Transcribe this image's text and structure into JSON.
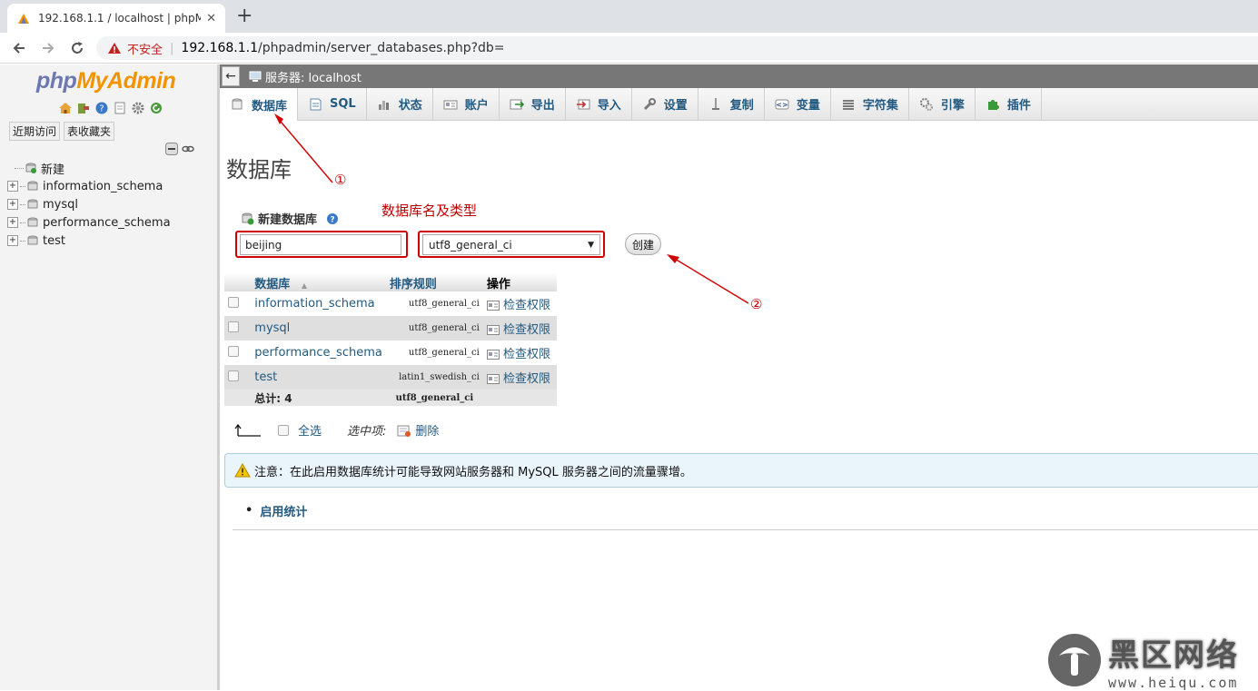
{
  "browser": {
    "tab_title": "192.168.1.1 / localhost | phpM",
    "tab_close": "✕",
    "new_tab": "+",
    "security_label": "不安全",
    "url_host": "192.168.1.1",
    "url_path": "/phpadmin/server_databases.php?db="
  },
  "sidebar": {
    "logo_php": "php",
    "logo_myadmin": "MyAdmin",
    "recent_label": "近期访问",
    "favorites_label": "表收藏夹",
    "tree": [
      {
        "label": "新建"
      },
      {
        "label": "information_schema"
      },
      {
        "label": "mysql"
      },
      {
        "label": "performance_schema"
      },
      {
        "label": "test"
      }
    ]
  },
  "server_bar": {
    "back": "←",
    "label": "服务器: localhost"
  },
  "menu": {
    "tabs": [
      {
        "label": "数据库",
        "icon": "database-icon"
      },
      {
        "label": "SQL",
        "icon": "sql-icon"
      },
      {
        "label": "状态",
        "icon": "status-icon"
      },
      {
        "label": "账户",
        "icon": "accounts-icon"
      },
      {
        "label": "导出",
        "icon": "export-icon"
      },
      {
        "label": "导入",
        "icon": "import-icon"
      },
      {
        "label": "设置",
        "icon": "wrench-icon"
      },
      {
        "label": "复制",
        "icon": "replication-icon"
      },
      {
        "label": "变量",
        "icon": "variables-icon"
      },
      {
        "label": "字符集",
        "icon": "charset-icon"
      },
      {
        "label": "引擎",
        "icon": "engine-icon"
      },
      {
        "label": "插件",
        "icon": "plugin-icon"
      }
    ]
  },
  "page": {
    "title": "数据库",
    "create_label": "新建数据库",
    "annotation_text": "数据库名及类型",
    "dbname_value": "beijing",
    "collation_value": "utf8_general_ci",
    "create_button": "创建",
    "marker_1": "①",
    "marker_2": "②"
  },
  "table": {
    "headers": {
      "database": "数据库",
      "sort": "▲",
      "collation": "排序规则",
      "action": "操作"
    },
    "rows": [
      {
        "name": "information_schema",
        "collation": "utf8_general_ci",
        "action": "检查权限"
      },
      {
        "name": "mysql",
        "collation": "utf8_general_ci",
        "action": "检查权限"
      },
      {
        "name": "performance_schema",
        "collation": "utf8_general_ci",
        "action": "检查权限"
      },
      {
        "name": "test",
        "collation": "latin1_swedish_ci",
        "action": "检查权限"
      }
    ],
    "total_label": "总计: 4",
    "total_collation": "utf8_general_ci"
  },
  "bulk": {
    "select_all": "全选",
    "selected_label": "选中项:",
    "delete": "删除"
  },
  "notice": {
    "text": "注意：在此启用数据库统计可能导致网站服务器和 MySQL 服务器之间的流量骤增。"
  },
  "stats": {
    "bullet": "•",
    "link": "启用统计"
  },
  "watermark": {
    "cn": "黑区网络",
    "url": "www.heiqu.com"
  },
  "colors": {
    "link": "#235a81",
    "annotation": "#c00000",
    "logo_php": "#6c78af",
    "logo_myadmin": "#f29300"
  }
}
